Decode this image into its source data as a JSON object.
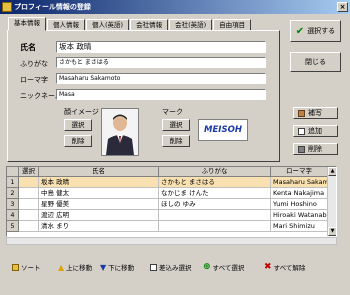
{
  "window": {
    "title": "プロフィール情報の登録",
    "close_glyph": "×"
  },
  "tabs": [
    {
      "label": "基本情報"
    },
    {
      "label": "個人情報"
    },
    {
      "label": "個人(英語)"
    },
    {
      "label": "会社情報"
    },
    {
      "label": "会社(英語)"
    },
    {
      "label": "自由項目"
    }
  ],
  "form": {
    "name_label": "氏名",
    "name_value": "坂本 政晴",
    "furigana_label": "ふりがな",
    "furigana_value": "さかもと まさはる",
    "romaji_label": "ローマ字",
    "romaji_value": "Masaharu Sakamoto",
    "nickname_label": "ニックネーム",
    "nickname_value": "Masa",
    "face_label": "顔イメージ",
    "mark_label": "マーク",
    "select_label": "選択",
    "delete_label": "削除",
    "logo_text": "MEISOH"
  },
  "side": {
    "select_label": "選択する",
    "close_label": "閉じる",
    "fix_label": "補写",
    "add_label": "追加",
    "delete_label": "削除"
  },
  "grid": {
    "headers": [
      "",
      "選択",
      "氏名",
      "ふりがな",
      "ローマ字"
    ],
    "rows": [
      {
        "num": "1",
        "check": "",
        "name": "坂本 政晴",
        "kana": "さかもと まさはる",
        "roman": "Masaharu Sakamoto"
      },
      {
        "num": "2",
        "check": "",
        "name": "中島 健太",
        "kana": "なかじま けんた",
        "roman": "Kenta Nakajima"
      },
      {
        "num": "3",
        "check": "",
        "name": "星野 優美",
        "kana": "ほしの ゆみ",
        "roman": "Yumi Hoshino"
      },
      {
        "num": "4",
        "check": "",
        "name": "渡辺 広明",
        "kana": "",
        "roman": "Hiroaki Watanabe"
      },
      {
        "num": "5",
        "check": "",
        "name": "清水 まり",
        "kana": "",
        "roman": "Mari Shimizu"
      }
    ]
  },
  "bottom": {
    "sort_label": "ソート",
    "up_label": "上に移動",
    "down_label": "下に移動",
    "filter_label": "差込み選択",
    "all_select_label": "すべて選択",
    "all_clear_label": "すべて解除"
  },
  "colors": {
    "accent": "#0a246a",
    "selected_row": "#f8e0b0",
    "logo": "#1a3aa8"
  }
}
